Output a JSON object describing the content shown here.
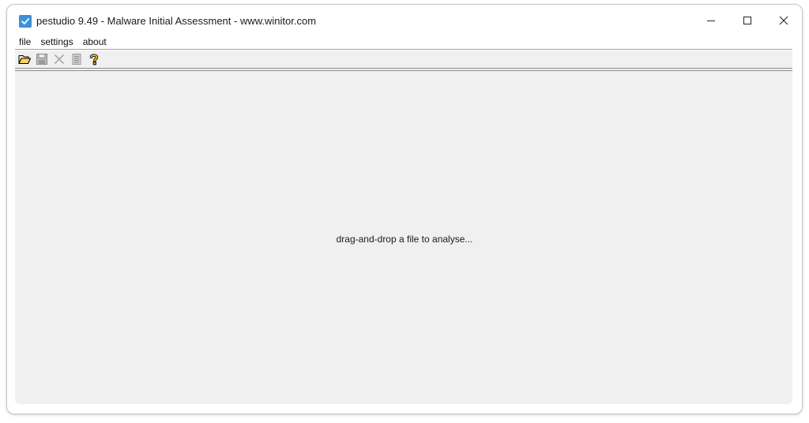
{
  "window": {
    "title": "pestudio 9.49 - Malware Initial Assessment - www.winitor.com",
    "app_icon": "checkbox-check-icon",
    "controls": [
      "minimize-icon",
      "maximize-icon",
      "close-icon"
    ]
  },
  "menu": {
    "file": "file",
    "settings": "settings",
    "about": "about"
  },
  "toolbar": {
    "icons": [
      "open-folder-icon",
      "save-disk-icon",
      "cut-cross-icon",
      "document-list-icon",
      "help-question-icon"
    ]
  },
  "main": {
    "hint": "drag-and-drop a file to analyse..."
  },
  "colors": {
    "app_icon_bg": "#3d8fd8",
    "client_bg": "#f0f0f0",
    "folder_yellow": "#f2c12e",
    "disabled_gray": "#a8a8a8"
  }
}
